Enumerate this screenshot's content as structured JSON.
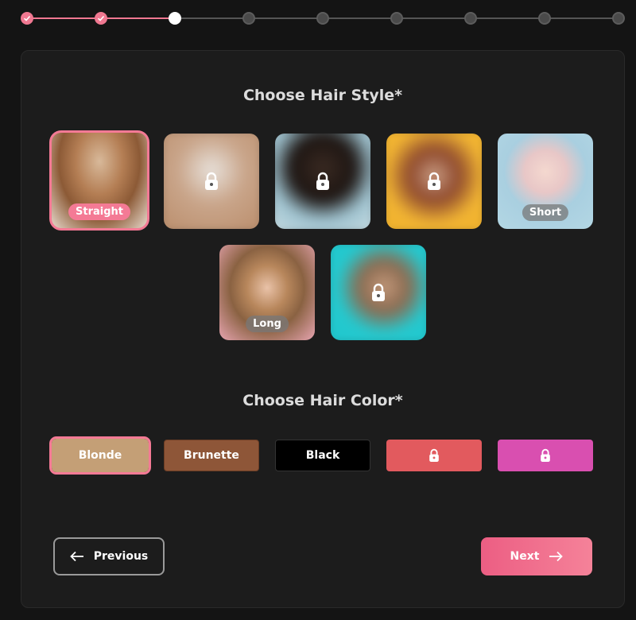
{
  "stepper": {
    "steps": [
      {
        "state": "done"
      },
      {
        "state": "done"
      },
      {
        "state": "current"
      },
      {
        "state": "todo"
      },
      {
        "state": "todo"
      },
      {
        "state": "todo"
      },
      {
        "state": "todo"
      },
      {
        "state": "todo"
      },
      {
        "state": "todo"
      }
    ]
  },
  "hair_style": {
    "title": "Choose Hair Style*",
    "options": [
      {
        "label": "Straight",
        "selected": true,
        "locked": false
      },
      {
        "label": "",
        "selected": false,
        "locked": true
      },
      {
        "label": "",
        "selected": false,
        "locked": true
      },
      {
        "label": "",
        "selected": false,
        "locked": true
      },
      {
        "label": "Short",
        "selected": false,
        "locked": false
      },
      {
        "label": "Long",
        "selected": false,
        "locked": false
      },
      {
        "label": "",
        "selected": false,
        "locked": true
      }
    ]
  },
  "hair_color": {
    "title": "Choose Hair Color*",
    "options": [
      {
        "label": "Blonde",
        "color": "#c49f76",
        "selected": true,
        "locked": false
      },
      {
        "label": "Brunette",
        "color": "#8e5638",
        "selected": false,
        "locked": false
      },
      {
        "label": "Black",
        "color": "#000000",
        "selected": false,
        "locked": false
      },
      {
        "label": "",
        "color": "#e25a5e",
        "selected": false,
        "locked": true
      },
      {
        "label": "",
        "color": "#d94fb0",
        "selected": false,
        "locked": true
      }
    ]
  },
  "nav": {
    "previous_label": "Previous",
    "next_label": "Next"
  },
  "colors": {
    "accent": "#f47a95",
    "background": "#141414",
    "panel": "#1c1c1c"
  }
}
